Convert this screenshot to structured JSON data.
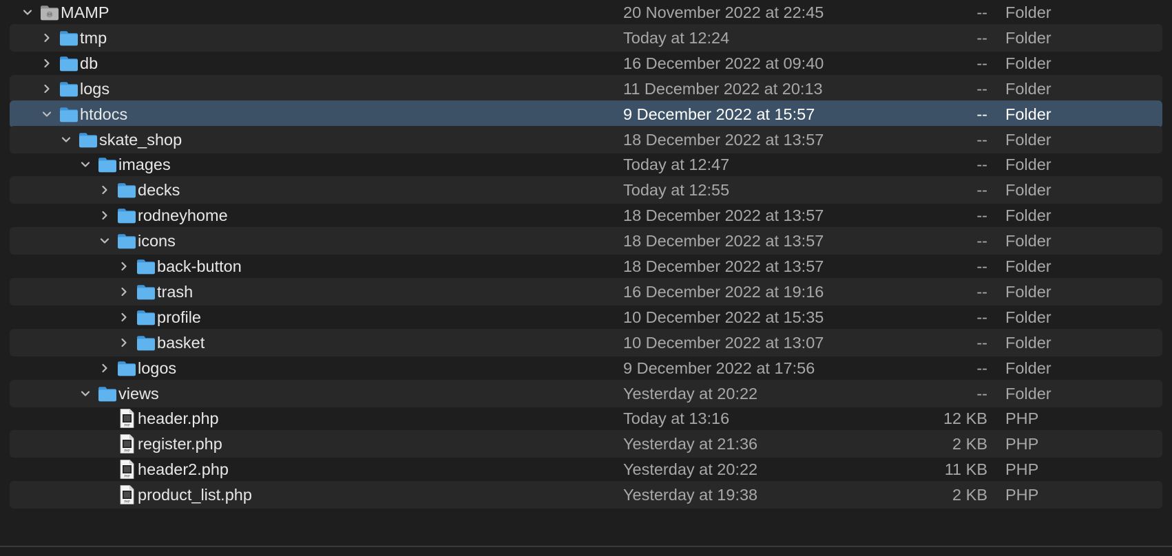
{
  "rows": [
    {
      "name": "MAMP",
      "date": "20 November 2022 at 22:45",
      "size": "--",
      "kind": "Folder",
      "level": 0,
      "icon": "mamp-folder-icon",
      "chevron": "down"
    },
    {
      "name": "tmp",
      "date": "Today at 12:24",
      "size": "--",
      "kind": "Folder",
      "level": 1,
      "icon": "folder-icon",
      "chevron": "right"
    },
    {
      "name": "db",
      "date": "16 December 2022 at 09:40",
      "size": "--",
      "kind": "Folder",
      "level": 1,
      "icon": "folder-icon",
      "chevron": "right"
    },
    {
      "name": "logs",
      "date": "11 December 2022 at 20:13",
      "size": "--",
      "kind": "Folder",
      "level": 1,
      "icon": "folder-icon",
      "chevron": "right"
    },
    {
      "name": "htdocs",
      "date": "9 December 2022 at 15:57",
      "size": "--",
      "kind": "Folder",
      "level": 1,
      "icon": "folder-icon",
      "chevron": "down",
      "selected": true
    },
    {
      "name": "skate_shop",
      "date": "18 December 2022 at 13:57",
      "size": "--",
      "kind": "Folder",
      "level": 2,
      "icon": "folder-icon",
      "chevron": "down"
    },
    {
      "name": "images",
      "date": "Today at 12:47",
      "size": "--",
      "kind": "Folder",
      "level": 3,
      "icon": "folder-icon",
      "chevron": "down"
    },
    {
      "name": "decks",
      "date": "Today at 12:55",
      "size": "--",
      "kind": "Folder",
      "level": 4,
      "icon": "folder-icon",
      "chevron": "right"
    },
    {
      "name": "rodneyhome",
      "date": "18 December 2022 at 13:57",
      "size": "--",
      "kind": "Folder",
      "level": 4,
      "icon": "folder-icon",
      "chevron": "right"
    },
    {
      "name": "icons",
      "date": "18 December 2022 at 13:57",
      "size": "--",
      "kind": "Folder",
      "level": 4,
      "icon": "folder-icon",
      "chevron": "down"
    },
    {
      "name": "back-button",
      "date": "18 December 2022 at 13:57",
      "size": "--",
      "kind": "Folder",
      "level": 5,
      "icon": "folder-icon",
      "chevron": "right"
    },
    {
      "name": "trash",
      "date": "16 December 2022 at 19:16",
      "size": "--",
      "kind": "Folder",
      "level": 5,
      "icon": "folder-icon",
      "chevron": "right"
    },
    {
      "name": "profile",
      "date": "10 December 2022 at 15:35",
      "size": "--",
      "kind": "Folder",
      "level": 5,
      "icon": "folder-icon",
      "chevron": "right"
    },
    {
      "name": "basket",
      "date": "10 December 2022 at 13:07",
      "size": "--",
      "kind": "Folder",
      "level": 5,
      "icon": "folder-icon",
      "chevron": "right"
    },
    {
      "name": "logos",
      "date": "9 December 2022 at 17:56",
      "size": "--",
      "kind": "Folder",
      "level": 4,
      "icon": "folder-icon",
      "chevron": "right"
    },
    {
      "name": "views",
      "date": "Yesterday at 20:22",
      "size": "--",
      "kind": "Folder",
      "level": 3,
      "icon": "folder-icon",
      "chevron": "down"
    },
    {
      "name": "header.php",
      "date": "Today at 13:16",
      "size": "12 KB",
      "kind": "PHP",
      "level": 4,
      "icon": "php-file-icon",
      "chevron": "none"
    },
    {
      "name": "register.php",
      "date": "Yesterday at 21:36",
      "size": "2 KB",
      "kind": "PHP",
      "level": 4,
      "icon": "php-file-icon",
      "chevron": "none"
    },
    {
      "name": "header2.php",
      "date": "Yesterday at 20:22",
      "size": "11 KB",
      "kind": "PHP",
      "level": 4,
      "icon": "php-file-icon",
      "chevron": "none"
    },
    {
      "name": "product_list.php",
      "date": "Yesterday at 19:38",
      "size": "2 KB",
      "kind": "PHP",
      "level": 4,
      "icon": "php-file-icon",
      "chevron": "none"
    }
  ],
  "colors": {
    "background": "#1e1e1e",
    "alt_row": "#282828",
    "selection": "#3c5066",
    "folder_blue": "#5fb4f0"
  }
}
